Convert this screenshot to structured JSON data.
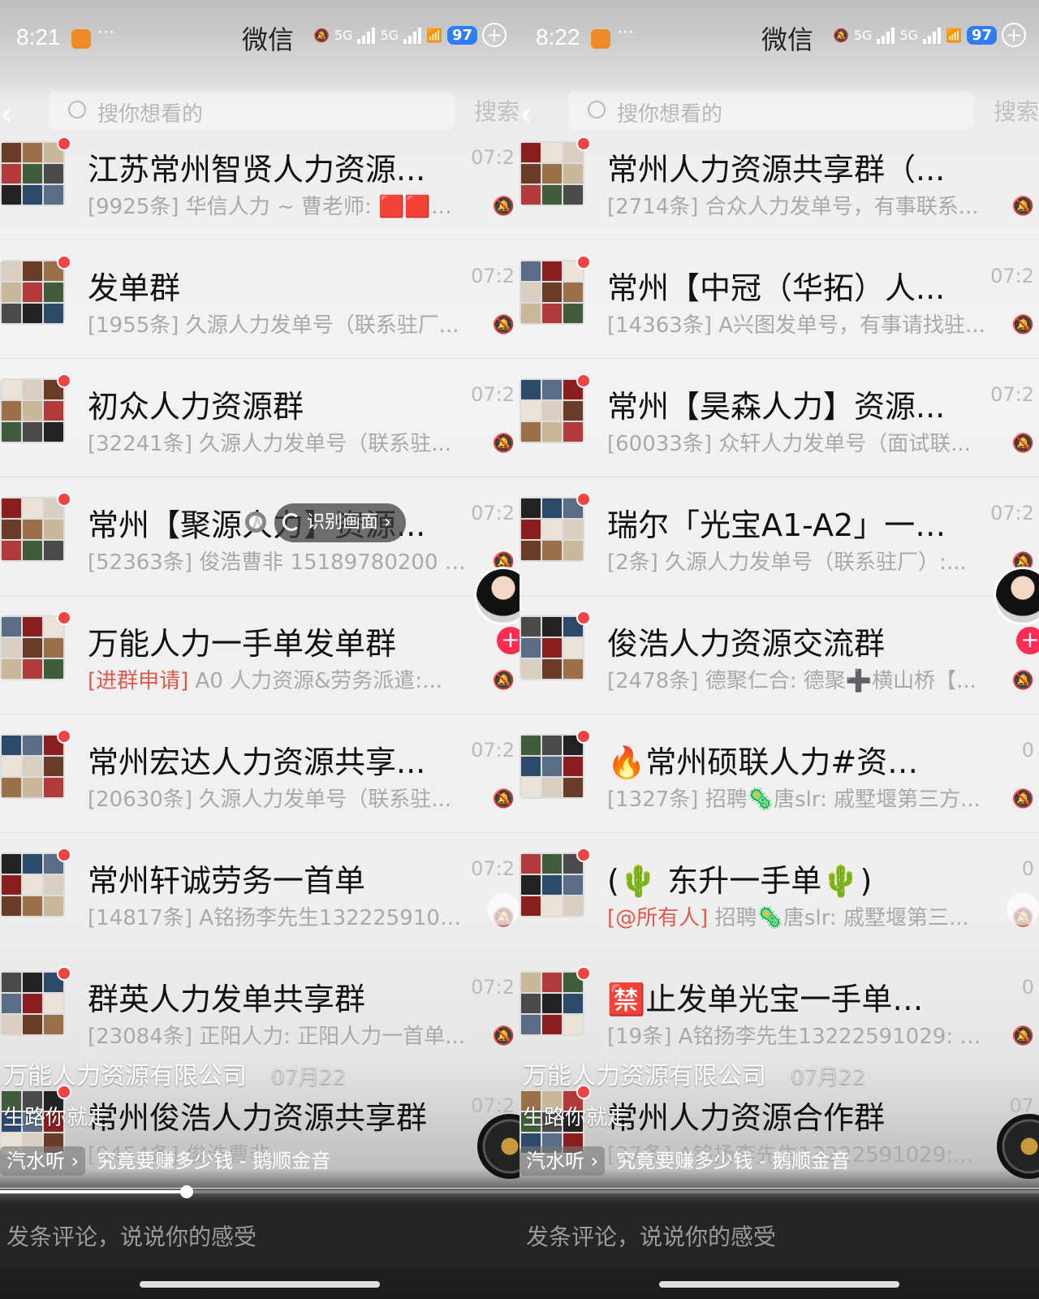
{
  "panels": [
    {
      "status": {
        "time": "8:21",
        "app_title": "微信",
        "network": "5G",
        "battery": "97"
      },
      "search": {
        "placeholder": "搜你想看的",
        "button": "搜索"
      },
      "chats": [
        {
          "name": "江苏常州智贤人力资源...",
          "preview": "[9925条] 华信人力 ~ 曹老师: 🟥🟥华...",
          "time": "07:2"
        },
        {
          "name": "发单群",
          "preview": "[1955条] 久源人力发单号（联系驻厂...",
          "time": "07:2"
        },
        {
          "name": "初众人力资源群",
          "preview": "[32241条] 久源人力发单号（联系驻...",
          "time": "07:2"
        },
        {
          "name": "常州【聚源人力】资源...",
          "preview": "[52363条] 俊浩曹非 15189780200 🎇🎇...",
          "time": "07:2"
        },
        {
          "name": "万能人力一手单发单群",
          "tag": "[进群申请]",
          "preview": " A0 人力资源&劳务派遣:...",
          "time": ""
        },
        {
          "name": "常州宏达人力资源共享...",
          "preview": "[20630条] 久源人力发单号（联系驻...",
          "time": "07:2"
        },
        {
          "name": "常州轩诚劳务一首单",
          "preview": "[14817条] A铭扬李先生13222591029...",
          "time": "07:2"
        },
        {
          "name": "群英人力发单共享群",
          "preview": "[23084条] 正阳人力: 正阳人力一首单...",
          "time": "07:2"
        },
        {
          "name": "常州俊浩人力资源共享群",
          "preview": "[9454条] 俊浩曹非...",
          "time": "07:2"
        }
      ],
      "pill_label": "识别画面",
      "video": {
        "title": "万能人力资源有限公司",
        "date": "07月22",
        "desc": "生路你就走",
        "music_chip": "汽水听",
        "music": "究竟要赚多少钱 - 鹅顺金音",
        "progress": 0.36
      },
      "comment_placeholder": "发条评论，说说你的感受"
    },
    {
      "status": {
        "time": "8:22",
        "app_title": "微信",
        "network": "5G",
        "battery": "97"
      },
      "search": {
        "placeholder": "搜你想看的",
        "button": "搜索"
      },
      "chats": [
        {
          "name": "常州人力资源共享群（...",
          "preview": "[2714条] 合众人力发单号，有事联系...",
          "time": ""
        },
        {
          "name": "常州【中冠（华拓）人...",
          "preview": "[14363条] A兴图发单号，有事请找驻...",
          "time": "07:2"
        },
        {
          "name": "常州【昊森人力】资源...",
          "preview": "[60033条] 众轩人力发单号（面试联...",
          "time": "07:2"
        },
        {
          "name": "瑞尔「光宝A1-A2」一手...",
          "preview": "[2条] 久源人力发单号（联系驻厂）:...",
          "time": "07:2"
        },
        {
          "name": "俊浩人力资源交流群",
          "preview": "[2478条] 德聚仁合: 德聚➕横山桥【...",
          "time": ""
        },
        {
          "name": "🔥常州硕联人力#资源群...",
          "preview": "[1327条] 招聘🦠唐slr: 戚墅堰第三方...",
          "time": "0"
        },
        {
          "name": "(🌵 东升一手单🌵)",
          "tag": "[@所有人]",
          "preview": " 招聘🦠唐slr: 戚墅堰第三...",
          "time": "0"
        },
        {
          "name": "🈲止发单光宝一手单发...",
          "preview": "[19条] A铭扬李先生13222591029: 铭...",
          "time": "0"
        },
        {
          "name": "常州人力资源合作群",
          "preview": "[37条] A铭扬李先生13222591029:...",
          "time": "07"
        }
      ],
      "video": {
        "title": "万能人力资源有限公司",
        "date": "07月22",
        "desc": "生路你就走",
        "music_chip": "汽水听",
        "music": "究竟要赚多少钱 - 鹅顺金音",
        "progress": 0.0
      },
      "comment_placeholder": "发条评论，说说你的感受"
    }
  ],
  "colors": {
    "accent_red": "#f04343",
    "plus_red": "#fe2c55",
    "battery_blue": "#2f7df6"
  }
}
